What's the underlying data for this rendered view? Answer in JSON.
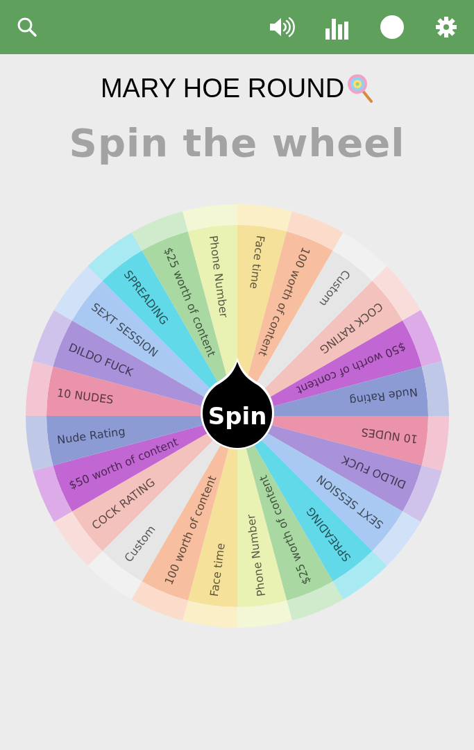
{
  "title": "MARY HOE ROUND",
  "heading": "Spin the wheel",
  "spin_button": "Spin",
  "wheel": {
    "segments": [
      {
        "label": "Face time",
        "color": "#f5e19a"
      },
      {
        "label": "100 worth of content",
        "color": "#f7bf9f"
      },
      {
        "label": "Custom",
        "color": "#e6e6e6"
      },
      {
        "label": "COCK RATING",
        "color": "#f4c2bd"
      },
      {
        "label": "$50 worth of content",
        "color": "#c266d4"
      },
      {
        "label": "Nude Rating",
        "color": "#8c9bd4"
      },
      {
        "label": "10 NUDES",
        "color": "#ea93ab"
      },
      {
        "label": "DILDO FUCK",
        "color": "#aa92da"
      },
      {
        "label": "SEXT SESSION",
        "color": "#a9c9f2"
      },
      {
        "label": "SPREADING",
        "color": "#62d9e8"
      },
      {
        "label": "$25 worth of content",
        "color": "#a9d8a3"
      },
      {
        "label": "Phone Number",
        "color": "#e9f1b3"
      },
      {
        "label": "Face time",
        "color": "#f5e19a"
      },
      {
        "label": "100 worth of content",
        "color": "#f7bf9f"
      },
      {
        "label": "Custom",
        "color": "#e6e6e6"
      },
      {
        "label": "COCK RATING",
        "color": "#f4c2bd"
      },
      {
        "label": "$50 worth of content",
        "color": "#c266d4"
      },
      {
        "label": "Nude Rating",
        "color": "#8c9bd4"
      },
      {
        "label": "10 NUDES",
        "color": "#ea93ab"
      },
      {
        "label": "DILDO FUCK",
        "color": "#aa92da"
      },
      {
        "label": "SEXT SESSION",
        "color": "#a9c9f2"
      },
      {
        "label": "SPREADING",
        "color": "#62d9e8"
      },
      {
        "label": "$25 worth of content",
        "color": "#a9d8a3"
      },
      {
        "label": "Phone Number",
        "color": "#e9f1b3"
      }
    ]
  }
}
